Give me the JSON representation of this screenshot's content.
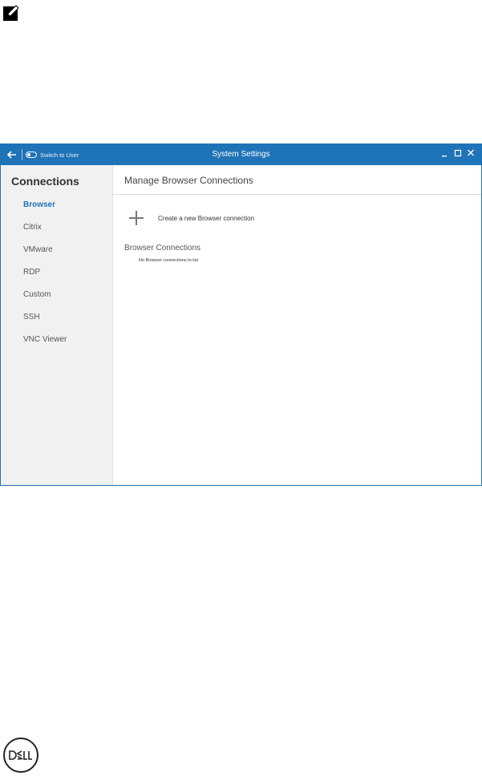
{
  "window": {
    "title": "System Settings",
    "switch_label": "Switch to User",
    "accent_color": "#1f73b7"
  },
  "icons": {
    "note": "pencil-note-icon",
    "back": "back-arrow-icon",
    "toggle": "toggle-icon",
    "minimize": "minimize-icon",
    "maximize": "maximize-icon",
    "close": "close-icon",
    "add": "plus-icon",
    "brand": "dell-logo"
  },
  "sidebar": {
    "title": "Connections",
    "items": [
      {
        "label": "Browser",
        "active": true
      },
      {
        "label": "Citrix",
        "active": false
      },
      {
        "label": "VMware",
        "active": false
      },
      {
        "label": "RDP",
        "active": false
      },
      {
        "label": "Custom",
        "active": false
      },
      {
        "label": "SSH",
        "active": false
      },
      {
        "label": "VNC Viewer",
        "active": false
      }
    ]
  },
  "main": {
    "title": "Manage Browser Connections",
    "create_label": "Create a new Browser connection",
    "section_title": "Browser Connections",
    "empty_message": "No Browser connections to list"
  }
}
